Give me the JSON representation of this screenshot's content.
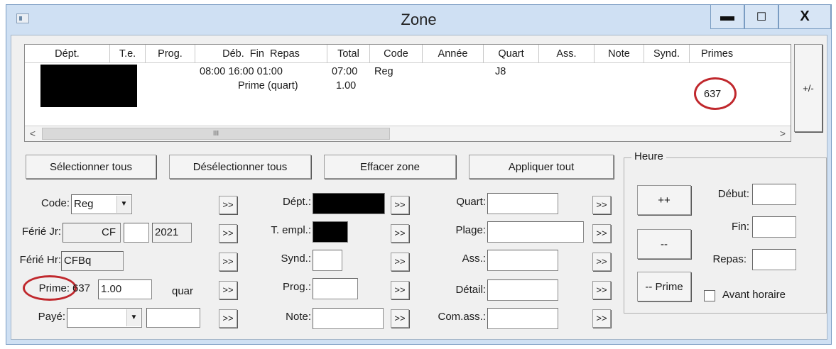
{
  "window": {
    "title": "Zone",
    "minimize": "▬",
    "maximize": "☐",
    "close": "X"
  },
  "grid": {
    "columns": [
      "Dépt.",
      "T.e.",
      "Prog.",
      "Déb.  Fin  Repas",
      "Total",
      "Code",
      "Année",
      "Quart",
      "Ass.",
      "Note",
      "Synd.",
      "Primes"
    ],
    "rows": [
      {
        "deb_fin_repas": "08:00 16:00 01:00",
        "total": "07:00",
        "code": "Reg",
        "quart": "J8",
        "primes": ""
      },
      {
        "deb_fin_repas": "Prime (quart)",
        "total": "1.00",
        "code": "",
        "quart": "",
        "primes": "637"
      }
    ],
    "scroll_thumb": "III",
    "scroll_left": "<",
    "scroll_right": ">"
  },
  "plusminus_label": "+/-",
  "actions": {
    "select_all": "Sélectionner tous",
    "deselect_all": "Désélectionner tous",
    "clear_zone": "Effacer zone",
    "apply_all": "Appliquer tout"
  },
  "form": {
    "code_label": "Code:",
    "code_value": "Reg",
    "ferie_jr_label": "Férié Jr:",
    "ferie_jr_value1": "CF",
    "ferie_jr_value2": "",
    "ferie_jr_year": "2021",
    "ferie_hr_label": "Férié Hr:",
    "ferie_hr_value": "CFBq",
    "prime_label": "Prime:",
    "prime_code": "637",
    "prime_qty": "1.00",
    "prime_unit": "quar",
    "paye_label": "Payé:",
    "paye_value": "",
    "paye_extra": "",
    "dept_label": "Dépt.:",
    "templ_label": "T. empl.:",
    "synd_label": "Synd.:",
    "prog_label": "Prog.:",
    "note_label": "Note:",
    "quart_label": "Quart:",
    "plage_label": "Plage:",
    "ass_label": "Ass.:",
    "detail_label": "Détail:",
    "comass_label": "Com.ass.:",
    "arrow": ">>"
  },
  "heure": {
    "title": "Heure",
    "plus_plus": "++",
    "minus_minus": "--",
    "minus_prime": "-- Prime",
    "debut_label": "Début:",
    "fin_label": "Fin:",
    "repas_label": "Repas:",
    "avant_horaire": "Avant horaire"
  },
  "colors": {
    "title_bar": "#cfe0f3",
    "highlight_circle": "#c0282d"
  }
}
